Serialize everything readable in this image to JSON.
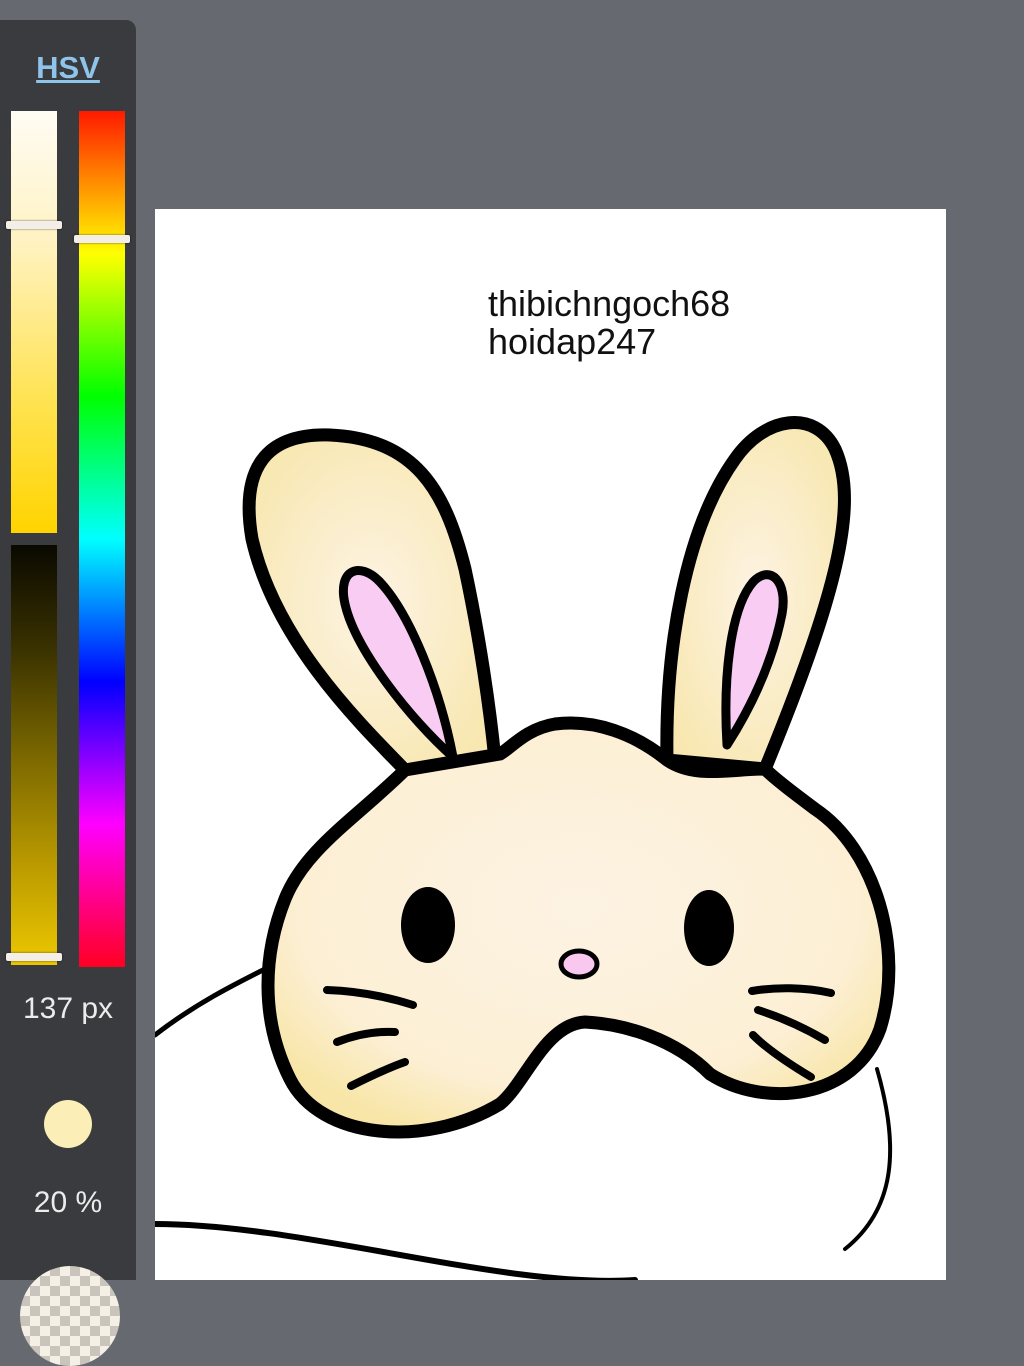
{
  "color_panel": {
    "mode_label": "HSV",
    "size_label": "137 px",
    "opacity_label": "20 %",
    "current_color": "#fbeeb6",
    "saturation_level": 0.27,
    "value_level": 0.98,
    "hue_level": 0.15
  },
  "canvas": {
    "text_line_1": "thibichngoch68",
    "text_line_2": "hoidap247"
  }
}
